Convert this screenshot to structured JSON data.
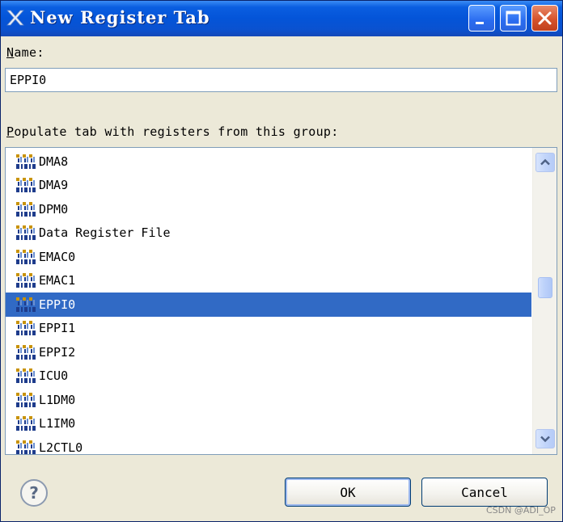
{
  "window": {
    "title": "New Register Tab",
    "colors": {
      "titlebar": "#0454D8",
      "selection": "#316AC5",
      "background": "#ECE9D8"
    }
  },
  "name_field": {
    "label_mnemonic": "N",
    "label_rest": "ame:",
    "value": "EPPI0"
  },
  "group_list": {
    "label_mnemonic": "P",
    "label_rest": "opulate tab with registers from this group:",
    "icon": "register-group-icon",
    "selected": "EPPI0",
    "items": [
      "DMA8",
      "DMA9",
      "DPM0",
      "Data Register File",
      "EMAC0",
      "EMAC1",
      "EPPI0",
      "EPPI1",
      "EPPI2",
      "ICU0",
      "L1DM0",
      "L1IM0",
      "L2CTL0"
    ]
  },
  "buttons": {
    "ok": "OK",
    "cancel": "Cancel",
    "help_icon": "help-icon"
  },
  "watermark": "CSDN @ADI_OP"
}
